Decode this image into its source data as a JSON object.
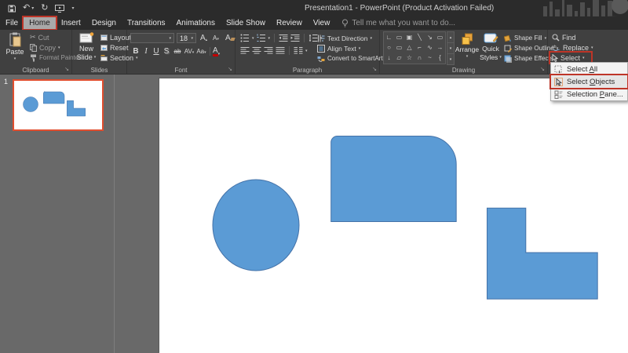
{
  "title_bar": {
    "title": "Presentation1 - PowerPoint (Product Activation Failed)"
  },
  "qat": {
    "undo_glyph": "↶",
    "redo_glyph": "↻",
    "customize_glyph": "▾"
  },
  "tabs": {
    "file": "File",
    "home": "Home",
    "insert": "Insert",
    "design": "Design",
    "transitions": "Transitions",
    "animations": "Animations",
    "slide_show": "Slide Show",
    "review": "Review",
    "view": "View",
    "tell_me": "Tell me what you want to do..."
  },
  "ribbon": {
    "clipboard": {
      "label": "Clipboard",
      "paste": "Paste",
      "cut": "Cut",
      "copy": "Copy",
      "format_painter": "Format Painter",
      "cut_glyph": "✂"
    },
    "slides": {
      "label": "Slides",
      "new": "New",
      "slide": "Slide",
      "layout": "Layout",
      "reset": "Reset",
      "section": "Section"
    },
    "font": {
      "label": "Font",
      "size": "18",
      "grow": "A",
      "shrink": "A",
      "clear": "A",
      "bold": "B",
      "italic": "I",
      "underline": "U",
      "shadow": "S",
      "strikethrough": "ab",
      "char_spacing": "AV",
      "change_case": "Aa",
      "color": "A"
    },
    "paragraph": {
      "label": "Paragraph",
      "text_direction": "Text Direction",
      "align_text": "Align Text",
      "convert_smartart": "Convert to SmartArt"
    },
    "drawing": {
      "label": "Drawing",
      "arrange": "Arrange",
      "quick": "Quick",
      "styles": "Styles",
      "shape_fill": "Shape Fill",
      "shape_outline": "Shape Outline",
      "shape_effects": "Shape Effects",
      "gallery": [
        "∟",
        "▭",
        "▣",
        "╲",
        "↘",
        "▭",
        "○",
        "▭",
        "△",
        "⌐",
        "∿",
        "→",
        "↓",
        "▱",
        "☆",
        "∩",
        "~",
        "{"
      ]
    },
    "editing": {
      "find": "Find",
      "replace": "Replace",
      "select": "Select"
    }
  },
  "select_menu": {
    "items": [
      {
        "pre": "Select ",
        "u": "A",
        "post": "ll"
      },
      {
        "pre": "Select ",
        "u": "O",
        "post": "bjects"
      },
      {
        "pre": "Selection ",
        "u": "P",
        "post": "ane..."
      }
    ]
  },
  "slide_panel": {
    "slide_number": "1"
  },
  "canvas": {
    "shapes": [
      "ellipse",
      "round-corner-rectangle",
      "l-shape"
    ]
  },
  "colors": {
    "shape_fill": "#5B9BD5",
    "shape_stroke": "#4472A8",
    "annotation_red": "#BE3528",
    "thumbnail_border": "#E04E2F",
    "ribbon_bg": "#404040",
    "chrome_bg": "#2B2B2B",
    "workspace_bg": "#696969"
  }
}
